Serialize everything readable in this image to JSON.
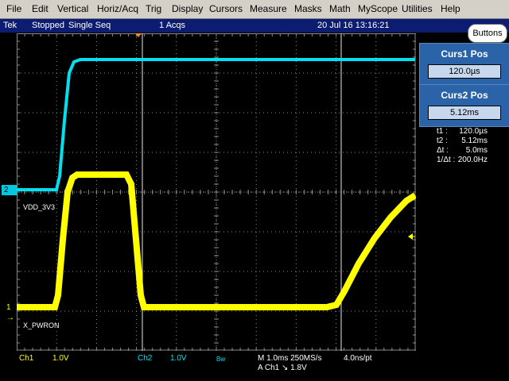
{
  "menu": [
    "File",
    "Edit",
    "Vertical",
    "Horiz/Acq",
    "Trig",
    "Display",
    "Cursors",
    "Measure",
    "Masks",
    "Math",
    "MyScope",
    "Utilities",
    "Help"
  ],
  "status": {
    "brand": "Tek",
    "run_state": "Stopped",
    "mode": "Single Seq",
    "acqs": "1 Acqs",
    "datetime": "20 Jul 16 13:16:21",
    "buttons_label": "Buttons"
  },
  "cursors": {
    "curs1_title": "Curs1 Pos",
    "curs1_value": "120.0µs",
    "curs2_title": "Curs2 Pos",
    "curs2_value": "5.12ms",
    "readout": [
      {
        "label": "t1 :",
        "value": "120.0µs"
      },
      {
        "label": "t2 :",
        "value": "5.12ms"
      },
      {
        "label": "Δt :",
        "value": "5.0ms"
      },
      {
        "label": "1/Δt :",
        "value": "200.0Hz"
      }
    ]
  },
  "traces": {
    "ch2_label": "VDD_3V3",
    "ch1_label": "X_PWRON",
    "ch1_marker": "1",
    "ch2_marker": "2"
  },
  "bottom": {
    "ch1_name": "Ch1",
    "ch1_scale": "1.0V",
    "ch2_name": "Ch2",
    "ch2_scale": "1.0V",
    "bw": "Bw",
    "timebase": "M 1.0ms 250MS/s",
    "sample_interval": "4.0ns/pt",
    "trigger": "A  Ch1  ↘  1.8V"
  },
  "colors": {
    "ch1": "#ffff00",
    "ch2": "#00e0f0",
    "panel_blue": "#2a63a8"
  }
}
